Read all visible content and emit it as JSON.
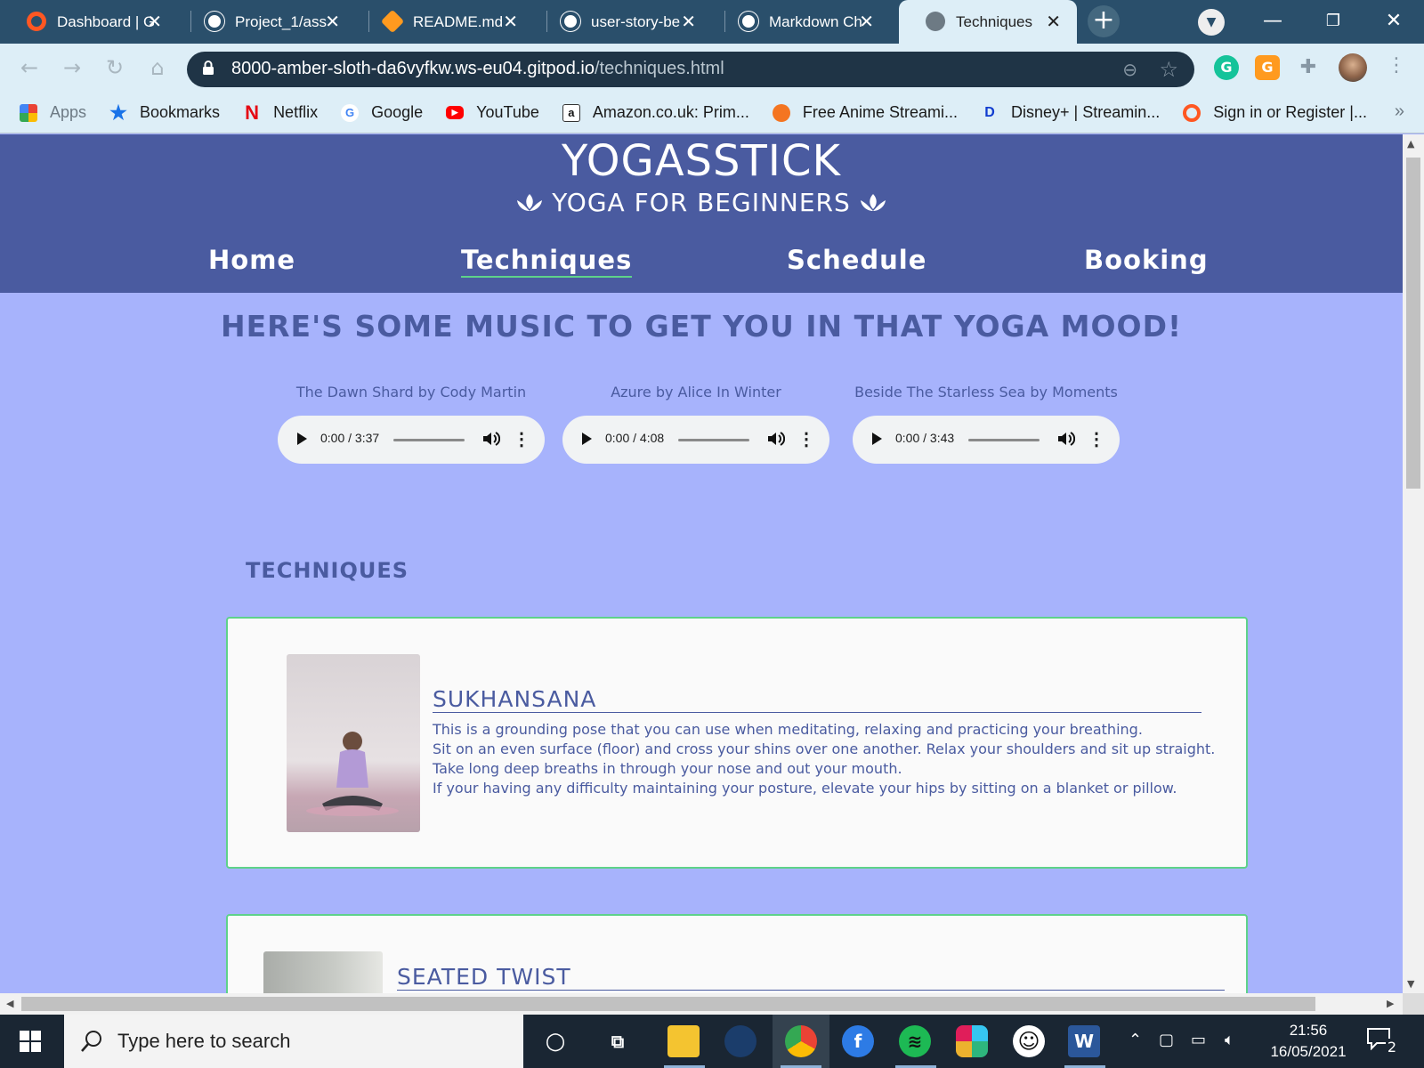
{
  "browser": {
    "tabs": [
      {
        "title": "Dashboard | G",
        "icon": "gitpod-icon",
        "color": "#ff5722"
      },
      {
        "title": "Project_1/ass",
        "icon": "github-icon",
        "color": "#ffffff"
      },
      {
        "title": "README.md",
        "icon": "grammarly-go-icon",
        "color": "#ff9a1f"
      },
      {
        "title": "user-story-be",
        "icon": "github-icon",
        "color": "#ffffff"
      },
      {
        "title": "Markdown Ch",
        "icon": "github-icon",
        "color": "#ffffff"
      },
      {
        "title": "Techniques",
        "icon": "globe-icon",
        "color": "#6d7a84",
        "active": true
      }
    ],
    "new_tab": "+",
    "url_host": "8000-amber-sloth-da6vyfkw.ws-eu04.gitpod.io",
    "url_path": "/techniques.html",
    "bookmarks": [
      {
        "label": "Apps",
        "icon": "apps-grid-icon"
      },
      {
        "label": "Bookmarks",
        "icon": "star-icon"
      },
      {
        "label": "Netflix",
        "icon": "netflix-icon"
      },
      {
        "label": "Google",
        "icon": "google-icon"
      },
      {
        "label": "YouTube",
        "icon": "youtube-icon"
      },
      {
        "label": "Amazon.co.uk: Prim...",
        "icon": "amazon-icon"
      },
      {
        "label": "Free Anime Streami...",
        "icon": "crunchyroll-icon"
      },
      {
        "label": "Disney+ | Streamin...",
        "icon": "disney-icon"
      },
      {
        "label": "Sign in or Register |...",
        "icon": "gitpod-icon"
      }
    ],
    "bookmarks_more": "»"
  },
  "site": {
    "brand": "YOGASSTICK",
    "tagline": "YOGA FOR BEGINNERS",
    "nav": [
      {
        "label": "Home",
        "active": false
      },
      {
        "label": "Techniques",
        "active": true
      },
      {
        "label": "Schedule",
        "active": false
      },
      {
        "label": "Booking",
        "active": false
      }
    ],
    "music_heading": "HERE'S SOME MUSIC TO GET YOU IN THAT YOGA MOOD!",
    "tracks": [
      {
        "title": "The Dawn Shard by Cody Martin",
        "time": "0:00 / 3:37"
      },
      {
        "title": "Azure by Alice In Winter",
        "time": "0:00 / 4:08"
      },
      {
        "title": "Beside The Starless Sea by Moments",
        "time": "0:00 / 3:43"
      }
    ],
    "techniques_heading": "TECHNIQUES",
    "techniques": [
      {
        "title": "SUKHANSANA",
        "lines": [
          "This is a grounding pose that you can use when meditating, relaxing and practicing your breathing.",
          "Sit on an even surface (floor) and cross your shins over one another. Relax your shoulders and sit up straight.",
          "Take long deep breaths in through your nose and out your mouth.",
          "If your having any difficulty maintaining your posture, elevate your hips by sitting on a blanket or pillow."
        ]
      },
      {
        "title": "SEATED TWIST",
        "lines": []
      }
    ]
  },
  "taskbar": {
    "search_placeholder": "Type here to search",
    "time": "21:56",
    "date": "16/05/2021",
    "notification_count": "2"
  },
  "colors": {
    "header_bg": "#4a5ba0",
    "page_bg": "#a7b3fc",
    "accent_green": "#5ed28a",
    "tabstrip_bg": "#2a4f6b"
  }
}
